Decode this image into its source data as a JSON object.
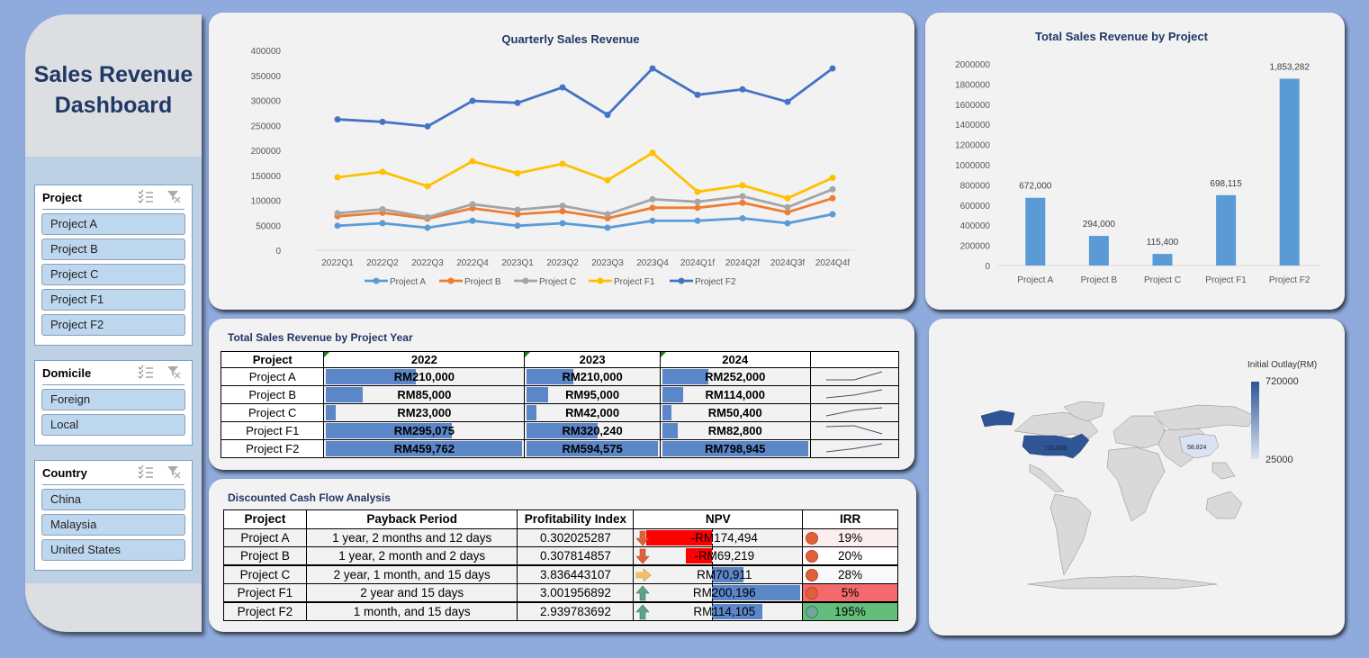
{
  "sidebar": {
    "title_line1": "Sales Revenue",
    "title_line2": "Dashboard",
    "slicers": [
      {
        "name": "Project",
        "items": [
          "Project A",
          "Project B",
          "Project C",
          "Project F1",
          "Project F2"
        ]
      },
      {
        "name": "Domicile",
        "items": [
          "Foreign",
          "Local"
        ]
      },
      {
        "name": "Country",
        "items": [
          "China",
          "Malaysia",
          "United States"
        ]
      }
    ],
    "icons": {
      "multiselect": "multi-select-icon",
      "clear_filter": "clear-filter-icon"
    }
  },
  "chart_data": [
    {
      "type": "line",
      "title": "Quarterly Sales Revenue",
      "xlabel": "",
      "ylabel": "",
      "ylim": [
        0,
        400000
      ],
      "yticks": [
        0,
        50000,
        100000,
        150000,
        200000,
        250000,
        300000,
        350000,
        400000
      ],
      "categories": [
        "2022Q1",
        "2022Q2",
        "2022Q3",
        "2022Q4",
        "2023Q1",
        "2023Q2",
        "2023Q3",
        "2023Q4",
        "2024Q1f",
        "2024Q2f",
        "2024Q3f",
        "2024Q4f"
      ],
      "legend": "bottom",
      "series": [
        {
          "name": "Project A",
          "color": "#5b9bd5",
          "values": [
            49000,
            54000,
            45000,
            59000,
            49000,
            54000,
            45000,
            59000,
            59000,
            64000,
            54000,
            72000
          ]
        },
        {
          "name": "Project B",
          "color": "#ed7d31",
          "values": [
            68000,
            75000,
            63000,
            84000,
            72000,
            78000,
            64000,
            85000,
            85000,
            95000,
            76000,
            104000
          ]
        },
        {
          "name": "Project C",
          "color": "#a5a5a5",
          "values": [
            74000,
            82000,
            66000,
            92000,
            81000,
            89000,
            72000,
            102000,
            97000,
            108000,
            86000,
            122000
          ]
        },
        {
          "name": "Project F1",
          "color": "#ffc000",
          "values": [
            146000,
            157000,
            128000,
            178000,
            154000,
            173000,
            140000,
            195000,
            117000,
            130000,
            104000,
            145000
          ]
        },
        {
          "name": "Project F2",
          "color": "#4472c4",
          "values": [
            262000,
            257000,
            248000,
            299000,
            295000,
            326000,
            271000,
            364000,
            311000,
            322000,
            297000,
            364000
          ]
        }
      ]
    },
    {
      "type": "bar",
      "title": "Total Sales Revenue by Project",
      "xlabel": "",
      "ylabel": "",
      "ylim": [
        0,
        2000000
      ],
      "yticks": [
        0,
        200000,
        400000,
        600000,
        800000,
        1000000,
        1200000,
        1400000,
        1600000,
        1800000,
        2000000
      ],
      "categories": [
        "Project A",
        "Project B",
        "Project C",
        "Project F1",
        "Project F2"
      ],
      "values": [
        672000,
        294000,
        115400,
        698115,
        1853282
      ],
      "data_labels": [
        "672,000",
        "294,000",
        "115,400",
        "698,115",
        "1,853,282"
      ],
      "color": "#5b9bd5"
    }
  ],
  "year_table": {
    "title": "Total Sales Revenue by Project Year",
    "headers": [
      "Project",
      "2022",
      "2023",
      "2024",
      ""
    ],
    "rows": [
      {
        "project": "Project A",
        "values": [
          210000,
          210000,
          252000
        ],
        "labels": [
          "RM210,000",
          "RM210,000",
          "RM252,000"
        ]
      },
      {
        "project": "Project B",
        "values": [
          85000,
          95000,
          114000
        ],
        "labels": [
          "RM85,000",
          "RM95,000",
          "RM114,000"
        ]
      },
      {
        "project": "Project C",
        "values": [
          23000,
          42000,
          50400
        ],
        "labels": [
          "RM23,000",
          "RM42,000",
          "RM50,400"
        ]
      },
      {
        "project": "Project F1",
        "values": [
          295075,
          320240,
          82800
        ],
        "labels": [
          "RM295,075",
          "RM320,240",
          "RM82,800"
        ]
      },
      {
        "project": "Project F2",
        "values": [
          459762,
          594575,
          798945
        ],
        "labels": [
          "RM459,762",
          "RM594,575",
          "RM798,945"
        ]
      }
    ],
    "databar_color": "#5b86c8"
  },
  "dcf": {
    "title": "Discounted Cash Flow Analysis",
    "headers": [
      "Project",
      "Payback Period",
      "Profitability Index",
      "NPV",
      "IRR"
    ],
    "rows": [
      {
        "project": "Project A",
        "payback": "1 year, 2 months and 12 days",
        "pi": "0.302025287",
        "npv": -174494,
        "npv_label": "-RM174,494",
        "npv_icon": "arrow-down-icon",
        "irr": "19%",
        "irr_icon": "red-circle-icon",
        "irr_bg": "#fdeeee"
      },
      {
        "project": "Project B",
        "payback": "1 year, 2 month and 2 days",
        "pi": "0.307814857",
        "npv": -69219,
        "npv_label": "-RM69,219",
        "npv_icon": "arrow-down-icon",
        "irr": "20%",
        "irr_bg": "#ffffff",
        "irr_icon": "red-circle-icon"
      },
      {
        "project": "Project C",
        "payback": "2 year, 1 month, and 15 days",
        "pi": "3.836443107",
        "npv": 70911,
        "npv_label": "RM70,911",
        "npv_icon": "arrow-right-icon",
        "irr": "28%",
        "irr_bg": "#f7f9fb",
        "irr_icon": "red-circle-icon"
      },
      {
        "project": "Project F1",
        "payback": "2 year and 15 days",
        "pi": "3.001956892",
        "npv": 200196,
        "npv_label": "RM200,196",
        "npv_icon": "arrow-up-icon",
        "irr": "5%",
        "irr_bg": "#f4696b",
        "irr_icon": "red-circle-icon"
      },
      {
        "project": "Project F2",
        "payback": "1 month, and 15 days",
        "pi": "2.939783692",
        "npv": 114105,
        "npv_label": "RM114,105",
        "npv_icon": "arrow-up-icon",
        "irr": "195%",
        "irr_bg": "#63be7b",
        "irr_icon": "green-circle-icon"
      }
    ],
    "colors": {
      "negative": "#ff0000",
      "positive": "#5b86c8"
    }
  },
  "map": {
    "legend_title": "Initial Outlay(RM)",
    "legend_max": "720000",
    "legend_min": "25000",
    "labels": [
      {
        "country": "United States",
        "value": "720,000"
      },
      {
        "country": "China",
        "value": "58,824"
      }
    ],
    "colors": {
      "high": "#2f5597",
      "low": "#dae3f3",
      "none": "#d9d9d9"
    }
  }
}
